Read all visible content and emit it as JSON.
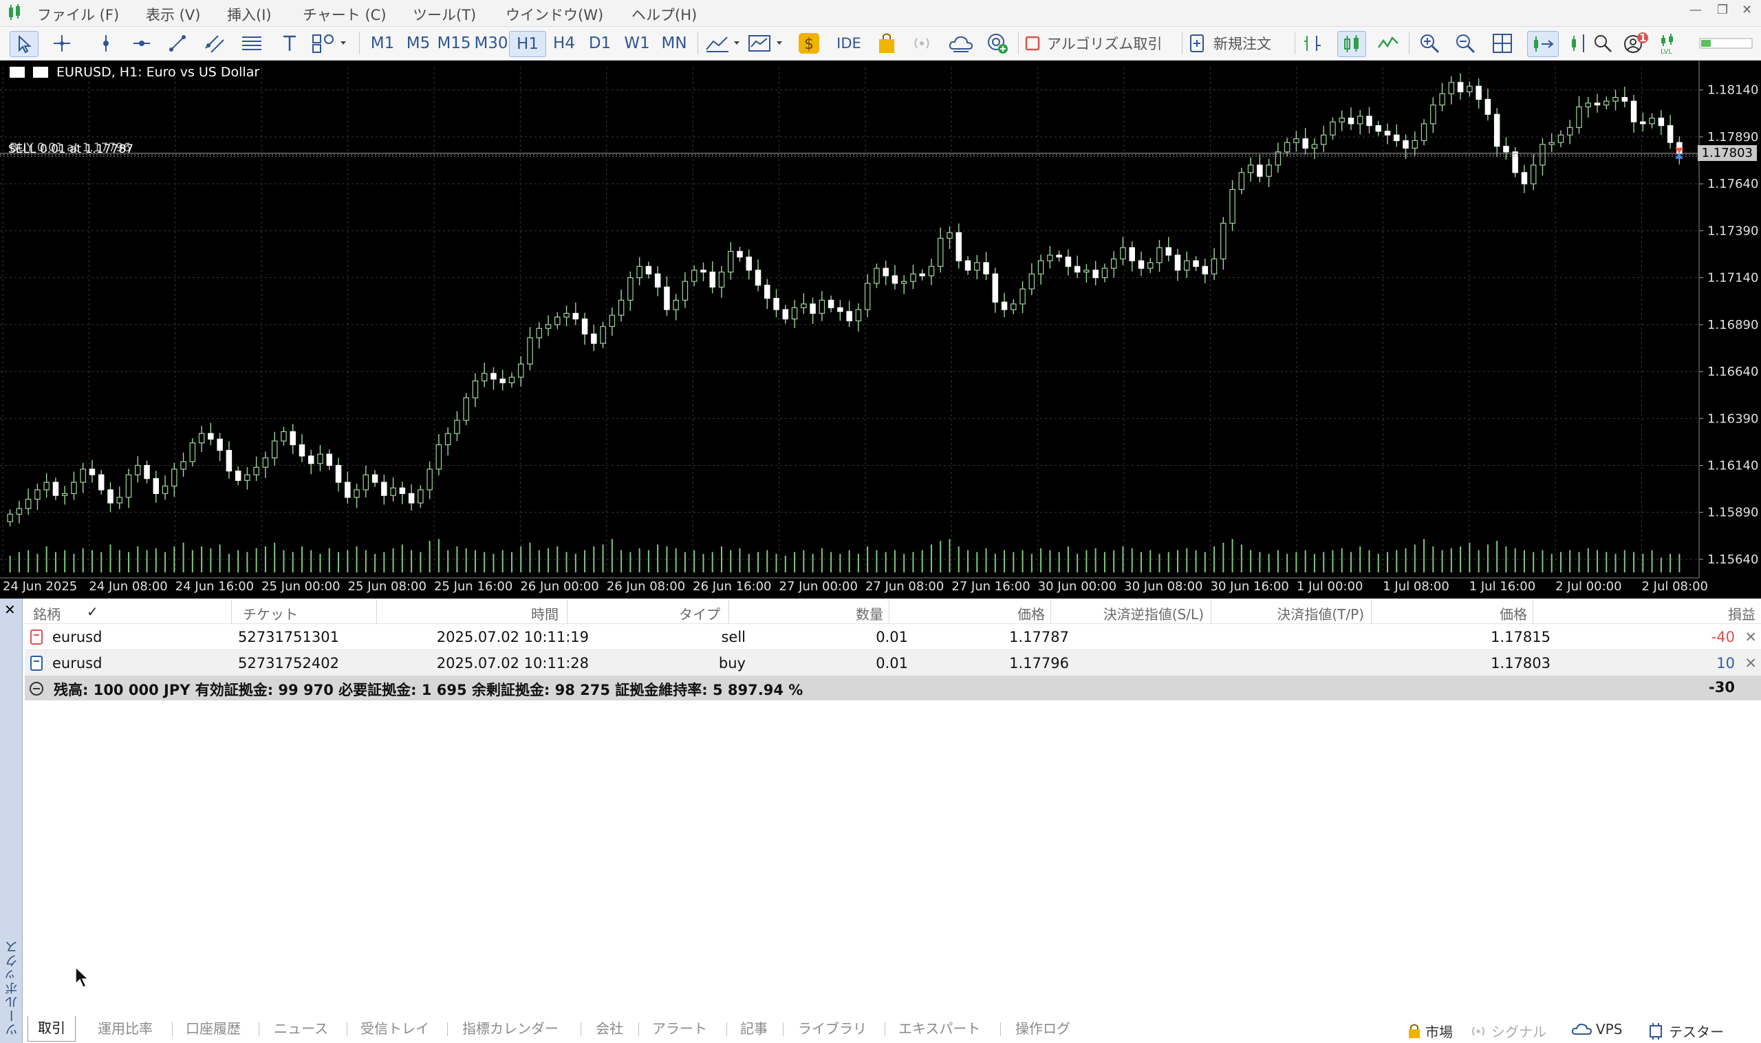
{
  "menu": [
    "ファイル (F)",
    "表示 (V)",
    "挿入(I)",
    "チャート (C)",
    "ツール(T)",
    "ウインドウ(W)",
    "ヘルプ(H)"
  ],
  "window_controls": {
    "minimize": "—",
    "restore": "❐",
    "close": "✕"
  },
  "toolbar": {
    "timeframes": [
      "M1",
      "M5",
      "M15",
      "M30",
      "H1",
      "H4",
      "D1",
      "W1",
      "MN"
    ],
    "active_timeframe": "H1",
    "ide_label": "IDE",
    "algo_label": "アルゴリズム取引",
    "new_order_label": "新規注文",
    "notification_count": "1"
  },
  "chart": {
    "title": "EURUSD, H1:  Euro vs US Dollar",
    "position_labels": [
      "SELL 0.01 at 1.17787",
      "BUY 0.01 at 1.17796"
    ],
    "current_price": "1.17803",
    "colors": {
      "background": "#000000",
      "candle_up": "#000000",
      "candle_down": "#ffffff",
      "wick": "#9fd59f",
      "volume": "#7ec87e",
      "grid": "#3a3a3a"
    }
  },
  "chart_data": {
    "type": "candlestick",
    "symbol": "EURUSD",
    "timeframe": "H1",
    "y_ticks": [
      "1.18140",
      "1.17890",
      "1.17640",
      "1.17390",
      "1.17140",
      "1.16890",
      "1.16640",
      "1.16390",
      "1.16140",
      "1.15890",
      "1.15640"
    ],
    "x_ticks": [
      "24 Jun 2025",
      "24 Jun 08:00",
      "24 Jun 16:00",
      "25 Jun 00:00",
      "25 Jun 08:00",
      "25 Jun 16:00",
      "26 Jun 00:00",
      "26 Jun 08:00",
      "26 Jun 16:00",
      "27 Jun 00:00",
      "27 Jun 08:00",
      "27 Jun 16:00",
      "30 Jun 00:00",
      "30 Jun 08:00",
      "30 Jun 16:00",
      "1 Jul 00:00",
      "1 Jul 08:00",
      "1 Jul 16:00",
      "2 Jul 00:00",
      "2 Jul 08:00"
    ],
    "ylim": [
      1.1557,
      1.1826
    ],
    "closes": [
      1.1588,
      1.1591,
      1.1596,
      1.1601,
      1.1605,
      1.1598,
      1.1599,
      1.1605,
      1.1612,
      1.1609,
      1.1601,
      1.1594,
      1.1597,
      1.1609,
      1.1614,
      1.1607,
      1.1599,
      1.1603,
      1.1612,
      1.1616,
      1.1626,
      1.1631,
      1.1628,
      1.1622,
      1.1611,
      1.1606,
      1.1609,
      1.1613,
      1.1618,
      1.1627,
      1.1632,
      1.1625,
      1.1619,
      1.1615,
      1.162,
      1.1614,
      1.1605,
      1.1597,
      1.1601,
      1.1609,
      1.1605,
      1.1598,
      1.1602,
      1.1599,
      1.1594,
      1.1601,
      1.1612,
      1.1625,
      1.1631,
      1.1638,
      1.165,
      1.1659,
      1.1663,
      1.166,
      1.1658,
      1.1661,
      1.1668,
      1.1682,
      1.1687,
      1.1689,
      1.1693,
      1.1695,
      1.1692,
      1.1684,
      1.1679,
      1.1688,
      1.1694,
      1.1702,
      1.1714,
      1.172,
      1.1716,
      1.1709,
      1.1697,
      1.1702,
      1.1712,
      1.1718,
      1.1717,
      1.1709,
      1.1717,
      1.1728,
      1.1725,
      1.1718,
      1.171,
      1.1703,
      1.1697,
      1.1692,
      1.1698,
      1.17,
      1.1695,
      1.1702,
      1.1698,
      1.1696,
      1.1691,
      1.1697,
      1.1711,
      1.1719,
      1.1715,
      1.1711,
      1.1712,
      1.1716,
      1.1715,
      1.172,
      1.1735,
      1.1738,
      1.1723,
      1.1718,
      1.1722,
      1.1716,
      1.1701,
      1.1697,
      1.17,
      1.1708,
      1.1716,
      1.1723,
      1.1726,
      1.1725,
      1.172,
      1.1717,
      1.1718,
      1.1714,
      1.1719,
      1.1724,
      1.173,
      1.1723,
      1.1719,
      1.1722,
      1.173,
      1.1726,
      1.1718,
      1.1723,
      1.172,
      1.1716,
      1.1724,
      1.1743,
      1.1761,
      1.177,
      1.1774,
      1.1768,
      1.1774,
      1.1781,
      1.1786,
      1.1788,
      1.1783,
      1.1785,
      1.179,
      1.1797,
      1.1799,
      1.1796,
      1.18,
      1.1795,
      1.1792,
      1.179,
      1.1787,
      1.1783,
      1.1787,
      1.1796,
      1.1806,
      1.1812,
      1.1818,
      1.1813,
      1.1816,
      1.1809,
      1.1801,
      1.1784,
      1.1781,
      1.177,
      1.1764,
      1.1774,
      1.1785,
      1.1786,
      1.179,
      1.1794,
      1.1805,
      1.1807,
      1.1806,
      1.1808,
      1.181,
      1.1808,
      1.1797,
      1.1796,
      1.1799,
      1.1795,
      1.1786,
      1.178
    ],
    "volumes": [
      0.45,
      0.55,
      0.6,
      0.5,
      0.7,
      0.55,
      0.6,
      0.5,
      0.65,
      0.6,
      0.55,
      0.75,
      0.6,
      0.55,
      0.7,
      0.6,
      0.65,
      0.55,
      0.7,
      0.8,
      0.6,
      0.7,
      0.65,
      0.75,
      0.5,
      0.6,
      0.55,
      0.65,
      0.7,
      0.8,
      0.6,
      0.55,
      0.7,
      0.6,
      0.5,
      0.65,
      0.55,
      0.6,
      0.7,
      0.6,
      0.5,
      0.55,
      0.65,
      0.75,
      0.6,
      0.55,
      0.85,
      0.9,
      0.6,
      0.7,
      0.65,
      0.6,
      0.55,
      0.5,
      0.6,
      0.55,
      0.7,
      0.8,
      0.6,
      0.65,
      0.7,
      0.55,
      0.5,
      0.6,
      0.7,
      0.75,
      0.9,
      0.6,
      0.55,
      0.65,
      0.6,
      0.75,
      0.7,
      0.65,
      0.55,
      0.6,
      0.5,
      0.55,
      0.7,
      0.6,
      0.65,
      0.5,
      0.55,
      0.6,
      0.5,
      0.45,
      0.55,
      0.6,
      0.5,
      0.65,
      0.55,
      0.5,
      0.6,
      0.5,
      0.7,
      0.6,
      0.55,
      0.6,
      0.5,
      0.55,
      0.6,
      0.75,
      0.85,
      0.9,
      0.7,
      0.6,
      0.55,
      0.65,
      0.5,
      0.6,
      0.55,
      0.6,
      0.5,
      0.65,
      0.6,
      0.55,
      0.7,
      0.5,
      0.6,
      0.65,
      0.55,
      0.6,
      0.7,
      0.65,
      0.55,
      0.6,
      0.5,
      0.55,
      0.6,
      0.65,
      0.6,
      0.55,
      0.7,
      0.8,
      0.9,
      0.75,
      0.6,
      0.55,
      0.5,
      0.6,
      0.5,
      0.55,
      0.6,
      0.5,
      0.55,
      0.6,
      0.65,
      0.55,
      0.7,
      0.6,
      0.5,
      0.55,
      0.6,
      0.65,
      0.75,
      0.9,
      0.7,
      0.6,
      0.65,
      0.7,
      0.8,
      0.6,
      0.75,
      0.85,
      0.7,
      0.65,
      0.6,
      0.55,
      0.6,
      0.5,
      0.55,
      0.6,
      0.55,
      0.65,
      0.6,
      0.55,
      0.5,
      0.6,
      0.55,
      0.5,
      0.6,
      0.4
    ]
  },
  "table": {
    "headers": [
      "銘柄",
      "✓",
      "チケット",
      "時間",
      "タイプ",
      "数量",
      "価格",
      "決済逆指値(S/L)",
      "決済指値(T/P)",
      "価格",
      "損益"
    ],
    "rows": [
      {
        "symbol": "eurusd",
        "ticket": "52731751301",
        "time": "2025.07.02 10:11:19",
        "type": "sell",
        "volume": "0.01",
        "price": "1.17787",
        "sl": "",
        "tp": "",
        "current": "1.17815",
        "profit": "-40",
        "profit_color": "#d9534f"
      },
      {
        "symbol": "eurusd",
        "ticket": "52731752402",
        "time": "2025.07.02 10:11:28",
        "type": "buy",
        "volume": "0.01",
        "price": "1.17796",
        "sl": "",
        "tp": "",
        "current": "1.17803",
        "profit": "10",
        "profit_color": "#2a5db0"
      }
    ],
    "summary": {
      "text": "残高: 100 000 JPY  有効証拠金: 99 970  必要証拠金: 1 695  余剰証拠金: 98 275  証拠金維持率: 5 897.94 %",
      "total": "-30"
    }
  },
  "toolbox": {
    "close_glyph": "✕",
    "vertical_label": "ツールボックス",
    "tabs": [
      "取引",
      "運用比率",
      "口座履歴",
      "ニュース",
      "受信トレイ",
      "指標カレンダー",
      "会社",
      "アラート",
      "記事",
      "ライブラリ",
      "エキスパート",
      "操作ログ"
    ],
    "active_tab": "取引"
  },
  "status": {
    "market": "市場",
    "signals": "シグナル",
    "vps": "VPS",
    "tester": "テスター"
  }
}
